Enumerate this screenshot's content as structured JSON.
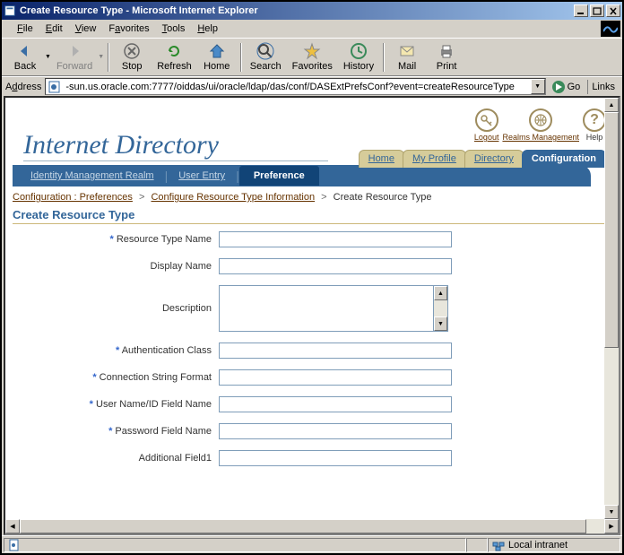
{
  "window": {
    "title": "Create Resource Type - Microsoft Internet Explorer"
  },
  "menus": {
    "file": "File",
    "edit": "Edit",
    "view": "View",
    "favorites": "Favorites",
    "tools": "Tools",
    "help": "Help"
  },
  "toolbar": {
    "back": "Back",
    "forward": "Forward",
    "stop": "Stop",
    "refresh": "Refresh",
    "home": "Home",
    "search": "Search",
    "favorites": "Favorites",
    "history": "History",
    "mail": "Mail",
    "print": "Print"
  },
  "address": {
    "label": "Address",
    "value": "-sun.us.oracle.com:7777/oiddas/ui/oracle/ldap/das/conf/DASExtPrefsConf?event=createResourceType",
    "go": "Go",
    "links": "Links"
  },
  "top_icons": {
    "logout": "Logout",
    "realms": "Realms Management",
    "help": "Help",
    "help_sym": "?"
  },
  "brand": "Internet Directory",
  "nav": {
    "home": "Home",
    "profile": "My Profile",
    "directory": "Directory",
    "config": "Configuration"
  },
  "subnav": {
    "realm": "Identity Management Realm",
    "user": "User Entry",
    "pref": "Preference"
  },
  "breadcrumb": {
    "p1": "Configuration : Preferences",
    "p2": "Configure Resource Type Information",
    "current": "Create Resource Type",
    "sep": ">"
  },
  "heading": "Create Resource Type",
  "form": {
    "resourceTypeName": {
      "label": "Resource Type Name",
      "value": "",
      "required": true
    },
    "displayName": {
      "label": "Display Name",
      "value": "",
      "required": false
    },
    "description": {
      "label": "Description",
      "value": "",
      "required": false
    },
    "authClass": {
      "label": "Authentication Class",
      "value": "",
      "required": true
    },
    "connString": {
      "label": "Connection String Format",
      "value": "",
      "required": true
    },
    "userIdField": {
      "label": "User Name/ID Field Name",
      "value": "",
      "required": true
    },
    "pwdField": {
      "label": "Password Field Name",
      "value": "",
      "required": true
    },
    "addField1": {
      "label": "Additional Field1",
      "value": "",
      "required": false
    }
  },
  "status": {
    "zone": "Local intranet"
  },
  "req_marker": "*"
}
